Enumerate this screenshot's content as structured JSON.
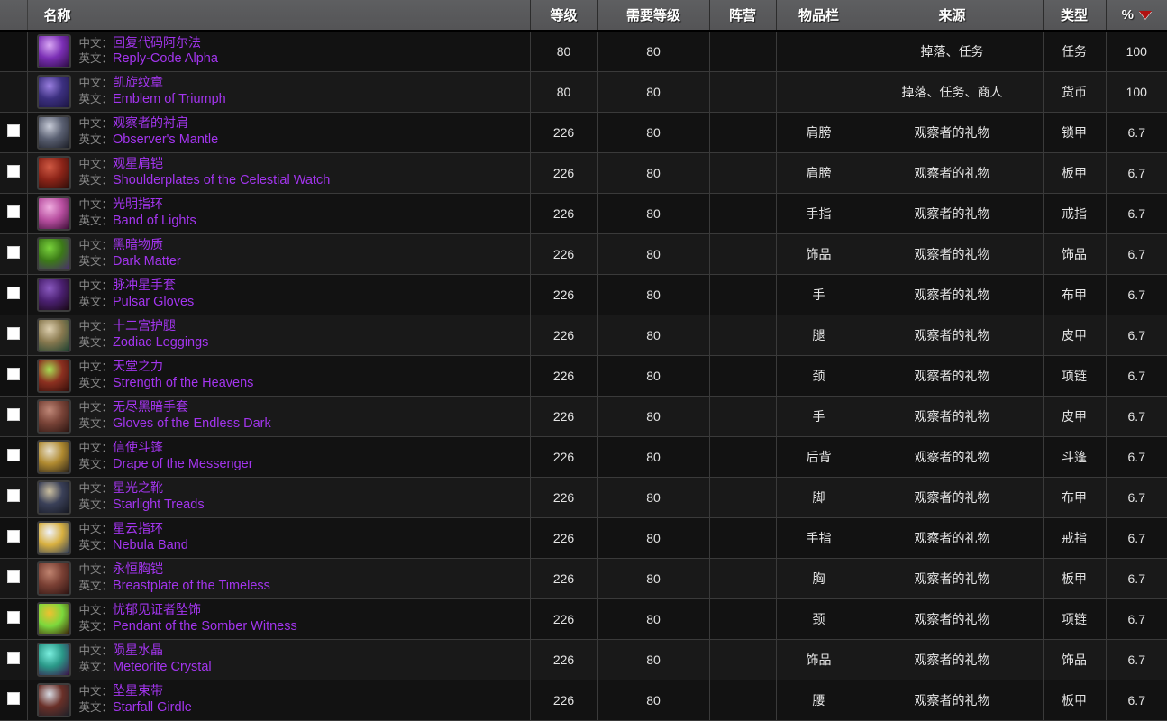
{
  "table": {
    "headers": {
      "checkbox": "",
      "name": "名称",
      "level": "等级",
      "required_level": "需要等级",
      "faction": "阵营",
      "slot": "物品栏",
      "source": "来源",
      "type": "类型",
      "percent": "%"
    },
    "sort": {
      "column": "%",
      "direction": "desc",
      "arrow_color": "#b01111"
    },
    "labels": {
      "zh": "中文：",
      "en": "英文："
    },
    "quality_color": "#a335ee",
    "rows": [
      {
        "checkbox": false,
        "name_zh": "回复代码阿尔法",
        "name_en": "Reply-Code Alpha",
        "level": "80",
        "required_level": "80",
        "faction": "",
        "slot": "",
        "source": "掉落、任务",
        "type": "任务",
        "percent": "100",
        "icon": {
          "name": "reply-code-alpha-icon",
          "colors": [
            "#d9a8f5",
            "#7b2fb5",
            "#2a0a40"
          ]
        }
      },
      {
        "checkbox": false,
        "name_zh": "凯旋纹章",
        "name_en": "Emblem of Triumph",
        "level": "80",
        "required_level": "80",
        "faction": "",
        "slot": "",
        "source": "掉落、任务、商人",
        "type": "货币",
        "percent": "100",
        "icon": {
          "name": "emblem-of-triumph-icon",
          "colors": [
            "#9a7fe0",
            "#3c3080",
            "#1a1440"
          ]
        }
      },
      {
        "checkbox": true,
        "name_zh": "观察者的衬肩",
        "name_en": "Observer's Mantle",
        "level": "226",
        "required_level": "80",
        "faction": "",
        "slot": "肩膀",
        "source": "观察者的礼物",
        "type": "锁甲",
        "percent": "6.7",
        "icon": {
          "name": "observers-mantle-icon",
          "colors": [
            "#c8ccd8",
            "#5a6072",
            "#1a1c24"
          ]
        }
      },
      {
        "checkbox": true,
        "name_zh": "观星肩铠",
        "name_en": "Shoulderplates of the Celestial Watch",
        "level": "226",
        "required_level": "80",
        "faction": "",
        "slot": "肩膀",
        "source": "观察者的礼物",
        "type": "板甲",
        "percent": "6.7",
        "icon": {
          "name": "shoulderplates-celestial-watch-icon",
          "colors": [
            "#d05a44",
            "#8c2418",
            "#2a0c08"
          ]
        }
      },
      {
        "checkbox": true,
        "name_zh": "光明指环",
        "name_en": "Band of Lights",
        "level": "226",
        "required_level": "80",
        "faction": "",
        "slot": "手指",
        "source": "观察者的礼物",
        "type": "戒指",
        "percent": "6.7",
        "icon": {
          "name": "band-of-lights-icon",
          "colors": [
            "#f0aee0",
            "#b84fa0",
            "#3a0c34"
          ]
        }
      },
      {
        "checkbox": true,
        "name_zh": "黑暗物质",
        "name_en": "Dark Matter",
        "level": "226",
        "required_level": "80",
        "faction": "",
        "slot": "饰品",
        "source": "观察者的礼物",
        "type": "饰品",
        "percent": "6.7",
        "icon": {
          "name": "dark-matter-icon",
          "colors": [
            "#7ad43c",
            "#3c7a18",
            "#4a2a70"
          ]
        }
      },
      {
        "checkbox": true,
        "name_zh": "脉冲星手套",
        "name_en": "Pulsar Gloves",
        "level": "226",
        "required_level": "80",
        "faction": "",
        "slot": "手",
        "source": "观察者的礼物",
        "type": "布甲",
        "percent": "6.7",
        "icon": {
          "name": "pulsar-gloves-icon",
          "colors": [
            "#8a5ac0",
            "#4a2070",
            "#15060f"
          ]
        }
      },
      {
        "checkbox": true,
        "name_zh": "十二宫护腿",
        "name_en": "Zodiac Leggings",
        "level": "226",
        "required_level": "80",
        "faction": "",
        "slot": "腿",
        "source": "观察者的礼物",
        "type": "皮甲",
        "percent": "6.7",
        "icon": {
          "name": "zodiac-leggings-icon",
          "colors": [
            "#ded0b0",
            "#8a7a50",
            "#1c4030"
          ]
        }
      },
      {
        "checkbox": true,
        "name_zh": "天堂之力",
        "name_en": "Strength of the Heavens",
        "level": "226",
        "required_level": "80",
        "faction": "",
        "slot": "颈",
        "source": "观察者的礼物",
        "type": "项链",
        "percent": "6.7",
        "icon": {
          "name": "strength-of-the-heavens-icon",
          "colors": [
            "#a8e055",
            "#8c3020",
            "#300c08"
          ]
        }
      },
      {
        "checkbox": true,
        "name_zh": "无尽黑暗手套",
        "name_en": "Gloves of the Endless Dark",
        "level": "226",
        "required_level": "80",
        "faction": "",
        "slot": "手",
        "source": "观察者的礼物",
        "type": "皮甲",
        "percent": "6.7",
        "icon": {
          "name": "gloves-endless-dark-icon",
          "colors": [
            "#c08878",
            "#7a4438",
            "#2a1410"
          ]
        }
      },
      {
        "checkbox": true,
        "name_zh": "信使斗篷",
        "name_en": "Drape of the Messenger",
        "level": "226",
        "required_level": "80",
        "faction": "",
        "slot": "后背",
        "source": "观察者的礼物",
        "type": "斗篷",
        "percent": "6.7",
        "icon": {
          "name": "drape-of-the-messenger-icon",
          "colors": [
            "#e8e0cc",
            "#b08a30",
            "#2a2218"
          ]
        }
      },
      {
        "checkbox": true,
        "name_zh": "星光之靴",
        "name_en": "Starlight Treads",
        "level": "226",
        "required_level": "80",
        "faction": "",
        "slot": "脚",
        "source": "观察者的礼物",
        "type": "布甲",
        "percent": "6.7",
        "icon": {
          "name": "starlight-treads-icon",
          "colors": [
            "#ccc0a0",
            "#3a4058",
            "#14161f"
          ]
        }
      },
      {
        "checkbox": true,
        "name_zh": "星云指环",
        "name_en": "Nebula Band",
        "level": "226",
        "required_level": "80",
        "faction": "",
        "slot": "手指",
        "source": "观察者的礼物",
        "type": "戒指",
        "percent": "6.7",
        "icon": {
          "name": "nebula-band-icon",
          "colors": [
            "#f0f4ff",
            "#d8b040",
            "#2c3a58"
          ]
        }
      },
      {
        "checkbox": true,
        "name_zh": "永恒胸铠",
        "name_en": "Breastplate of the Timeless",
        "level": "226",
        "required_level": "80",
        "faction": "",
        "slot": "胸",
        "source": "观察者的礼物",
        "type": "板甲",
        "percent": "6.7",
        "icon": {
          "name": "breastplate-of-the-timeless-icon",
          "colors": [
            "#c08470",
            "#7a4034",
            "#2a1210"
          ]
        }
      },
      {
        "checkbox": true,
        "name_zh": "忧郁见证者坠饰",
        "name_en": "Pendant of the Somber Witness",
        "level": "226",
        "required_level": "80",
        "faction": "",
        "slot": "颈",
        "source": "观察者的礼物",
        "type": "项链",
        "percent": "6.7",
        "icon": {
          "name": "pendant-somber-witness-icon",
          "colors": [
            "#f0c030",
            "#7cd83c",
            "#3a1c08"
          ]
        }
      },
      {
        "checkbox": true,
        "name_zh": "陨星水晶",
        "name_en": "Meteorite Crystal",
        "level": "226",
        "required_level": "80",
        "faction": "",
        "slot": "饰品",
        "source": "观察者的礼物",
        "type": "饰品",
        "percent": "6.7",
        "icon": {
          "name": "meteorite-crystal-icon",
          "colors": [
            "#7cf0e0",
            "#2a9888",
            "#3c1048"
          ]
        }
      },
      {
        "checkbox": true,
        "name_zh": "坠星束带",
        "name_en": "Starfall Girdle",
        "level": "226",
        "required_level": "80",
        "faction": "",
        "slot": "腰",
        "source": "观察者的礼物",
        "type": "板甲",
        "percent": "6.7",
        "icon": {
          "name": "starfall-girdle-icon",
          "colors": [
            "#d8dce4",
            "#6a3028",
            "#1c2028"
          ]
        }
      }
    ]
  }
}
